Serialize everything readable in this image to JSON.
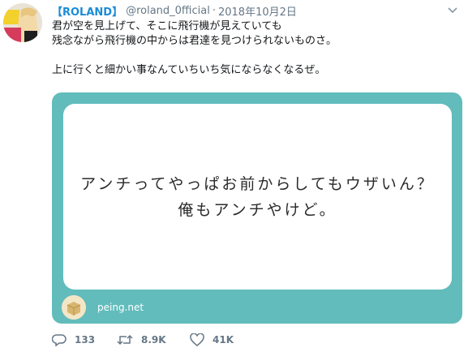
{
  "tweet": {
    "display_name": "【ROLAND】",
    "handle": "@roland_0fficial",
    "separator": "·",
    "date": "2018年10月2日",
    "text_lines": [
      "君が空を見上げて、そこに飛行機が見えていても",
      "残念ながら飛行機の中からは君達を見つけられないものさ。",
      "上に行くと細かい事なんていちいち気にならなくなるぜ。"
    ]
  },
  "card": {
    "question_lines": [
      "アンチってやっぱお前からしてもウザいん？",
      "俺もアンチやけど。"
    ],
    "domain": "peing.net"
  },
  "actions": {
    "reply_count": "133",
    "retweet_count": "8.9K",
    "like_count": "41K"
  },
  "colors": {
    "name_blue": "#1a8cd8",
    "card_teal": "#62bcbc",
    "meta_gray": "#657786"
  },
  "icons": [
    "avatar",
    "caret-down-icon",
    "peing-logo-icon",
    "reply-icon",
    "retweet-icon",
    "like-icon"
  ]
}
